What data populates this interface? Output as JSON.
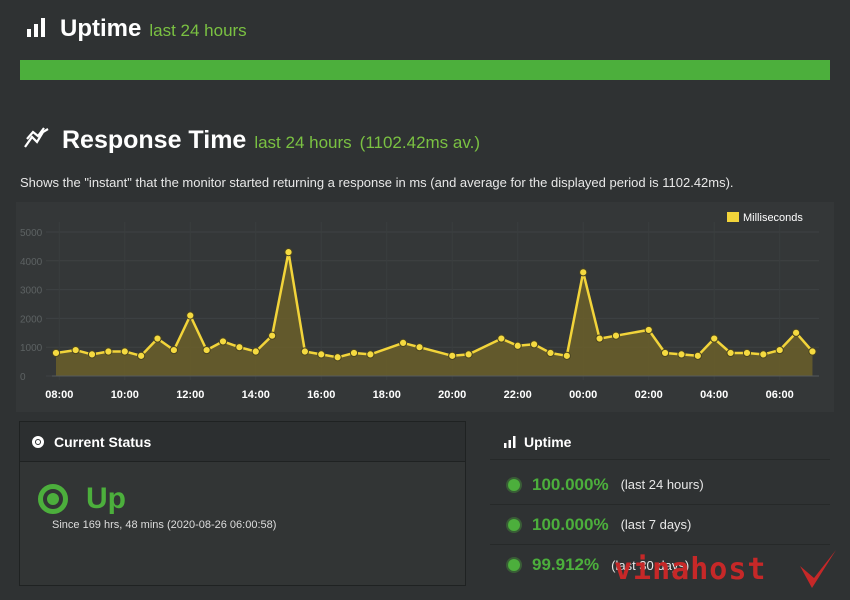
{
  "uptime_section": {
    "title": "Uptime",
    "period": "last 24 hours",
    "bar_fill_percent": 100
  },
  "response_section": {
    "title": "Response Time",
    "period": "last 24 hours",
    "average": "(1102.42ms av.)",
    "description": "Shows the \"instant\" that the monitor started returning a response in ms (and average for the displayed period is 1102.42ms)."
  },
  "chart_data": {
    "type": "area",
    "legend": "Milliseconds",
    "legend_position": "top-right",
    "y_ticks": [
      "0",
      "1000",
      "2000",
      "3000",
      "4000",
      "5000"
    ],
    "x_ticks": [
      "08:00",
      "10:00",
      "12:00",
      "14:00",
      "16:00",
      "18:00",
      "20:00",
      "22:00",
      "00:00",
      "02:00",
      "04:00",
      "06:00"
    ],
    "ylim": [
      0,
      5000
    ],
    "xlim": [
      7.9,
      31.2
    ],
    "x": [
      7.9,
      8.5,
      9.0,
      9.5,
      10.0,
      10.5,
      11.0,
      11.5,
      12.0,
      12.5,
      13.0,
      13.5,
      14.0,
      14.5,
      15.0,
      15.5,
      16.0,
      16.5,
      17.0,
      17.5,
      18.5,
      19.0,
      20.0,
      20.5,
      21.5,
      22.0,
      22.5,
      23.0,
      23.5,
      24.0,
      24.5,
      25.0,
      26.0,
      26.5,
      27.0,
      27.5,
      28.0,
      28.5,
      29.0,
      29.5,
      30.0,
      30.5,
      31.0
    ],
    "values": [
      800,
      900,
      750,
      850,
      850,
      700,
      1300,
      900,
      2100,
      900,
      1200,
      1000,
      850,
      1400,
      4300,
      850,
      750,
      650,
      800,
      750,
      1150,
      1000,
      700,
      750,
      1300,
      1050,
      1100,
      800,
      700,
      3600,
      1300,
      1400,
      1600,
      800,
      750,
      700,
      1300,
      800,
      800,
      750,
      900,
      1500,
      850
    ],
    "colors": {
      "line": "#f2d43a",
      "fill": "#6b5f2a",
      "marker": "#f5da40"
    }
  },
  "current_status": {
    "header": "Current Status",
    "state": "Up",
    "since": "Since 169 hrs, 48 mins (2020-08-26 06:00:58)"
  },
  "uptime_panel": {
    "header": "Uptime",
    "rows": [
      {
        "percent": "100.000%",
        "period": "(last 24 hours)"
      },
      {
        "percent": "100.000%",
        "period": "(last 7 days)"
      },
      {
        "percent": "99.912%",
        "period": "(last 30 days)"
      }
    ]
  },
  "watermark": "vinahost",
  "colors": {
    "accent_green": "#4caf3c",
    "sub_green": "#7ac142",
    "background": "#2f3233"
  }
}
